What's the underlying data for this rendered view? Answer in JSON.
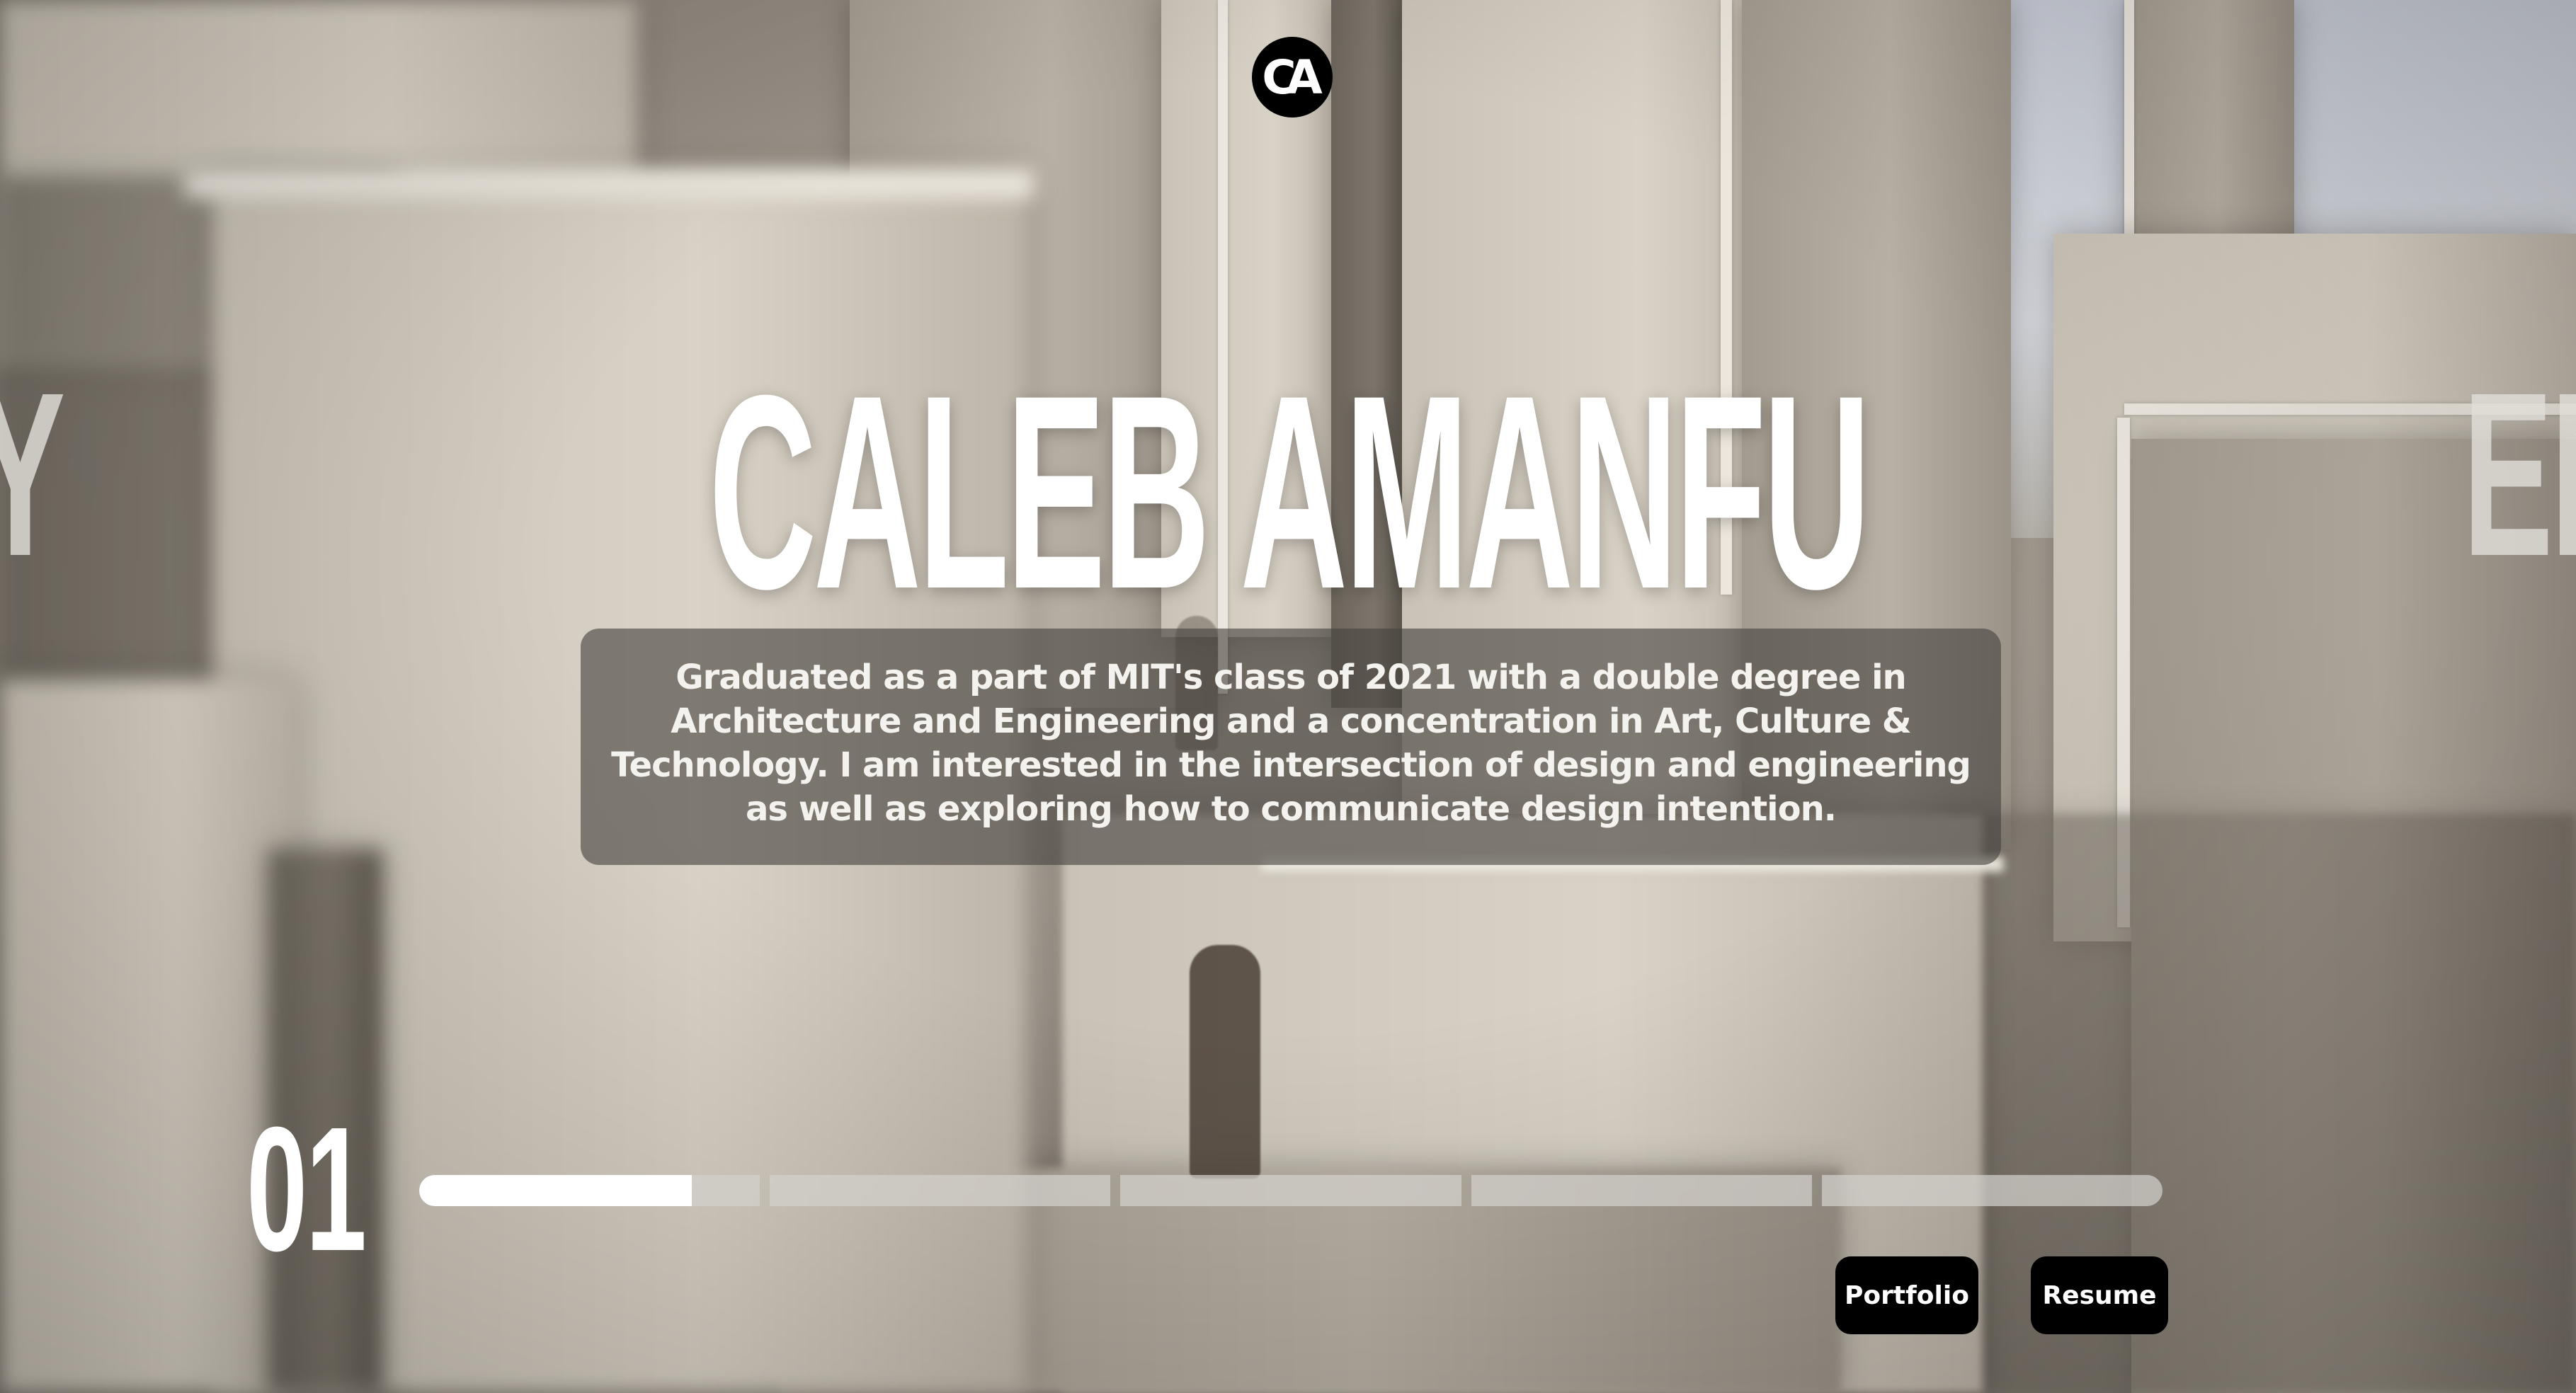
{
  "logo": {
    "text": "CA",
    "icon": "ca-monogram-logo"
  },
  "hero": {
    "name": "CALEB AMANFU",
    "side_left_text": "HY",
    "side_right_text": "EN"
  },
  "bio": {
    "text": "Graduated as a part of MIT's class of 2021 with a double degree in Architecture and Engineering and a concentration in Art, Culture & Technology. I am interested in the intersection of design and engineering as well as exploring how to communicate design intention."
  },
  "slideshow": {
    "current_number": "01",
    "segment_count": 5,
    "active_segment": 1,
    "active_progress": 0.8
  },
  "buttons": {
    "portfolio": "Portfolio",
    "resume": "Resume"
  },
  "colors": {
    "text": "#ffffff",
    "button_bg": "#000000",
    "bio_box_bg": "rgba(70,66,62,0.62)"
  }
}
